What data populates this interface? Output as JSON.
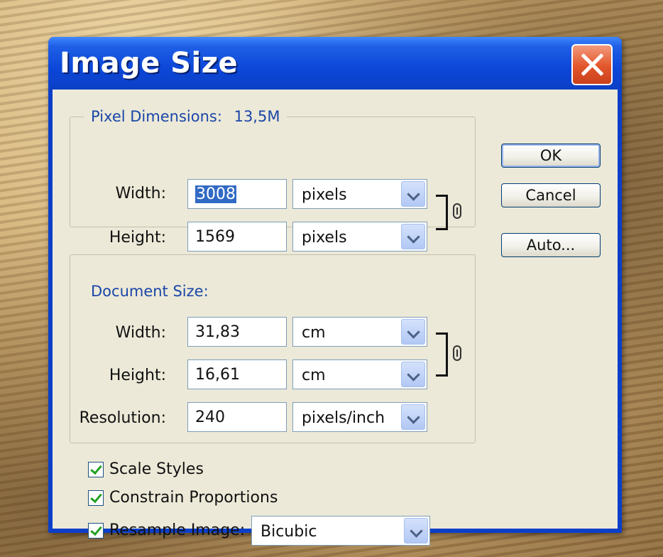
{
  "dialog": {
    "title": "Image Size"
  },
  "buttons": {
    "ok": "OK",
    "cancel": "Cancel",
    "auto": "Auto..."
  },
  "pixel_dimensions": {
    "legend": "Pixel Dimensions:",
    "size": "13,5M",
    "width_label": "Width:",
    "width_value": "3008",
    "width_unit": "pixels",
    "height_label": "Height:",
    "height_value": "1569",
    "height_unit": "pixels"
  },
  "document_size": {
    "legend": "Document Size:",
    "width_label": "Width:",
    "width_value": "31,83",
    "width_unit": "cm",
    "height_label": "Height:",
    "height_value": "16,61",
    "height_unit": "cm",
    "resolution_label": "Resolution:",
    "resolution_value": "240",
    "resolution_unit": "pixels/inch"
  },
  "options": {
    "scale_styles": "Scale Styles",
    "constrain_proportions": "Constrain Proportions",
    "resample_image": "Resample Image:",
    "resample_method": "Bicubic"
  },
  "icons": {
    "close": "close-icon",
    "link": "chain-link-icon",
    "dropdown": "chevron-down-icon",
    "checkmark": "checkmark-icon"
  },
  "colors": {
    "title_bar": "#0c47d8",
    "close_button": "#e2562a",
    "dialog_face": "#ece9d8",
    "group_legend": "#1a46a8",
    "selection": "#316ac5",
    "check": "#21a121"
  }
}
